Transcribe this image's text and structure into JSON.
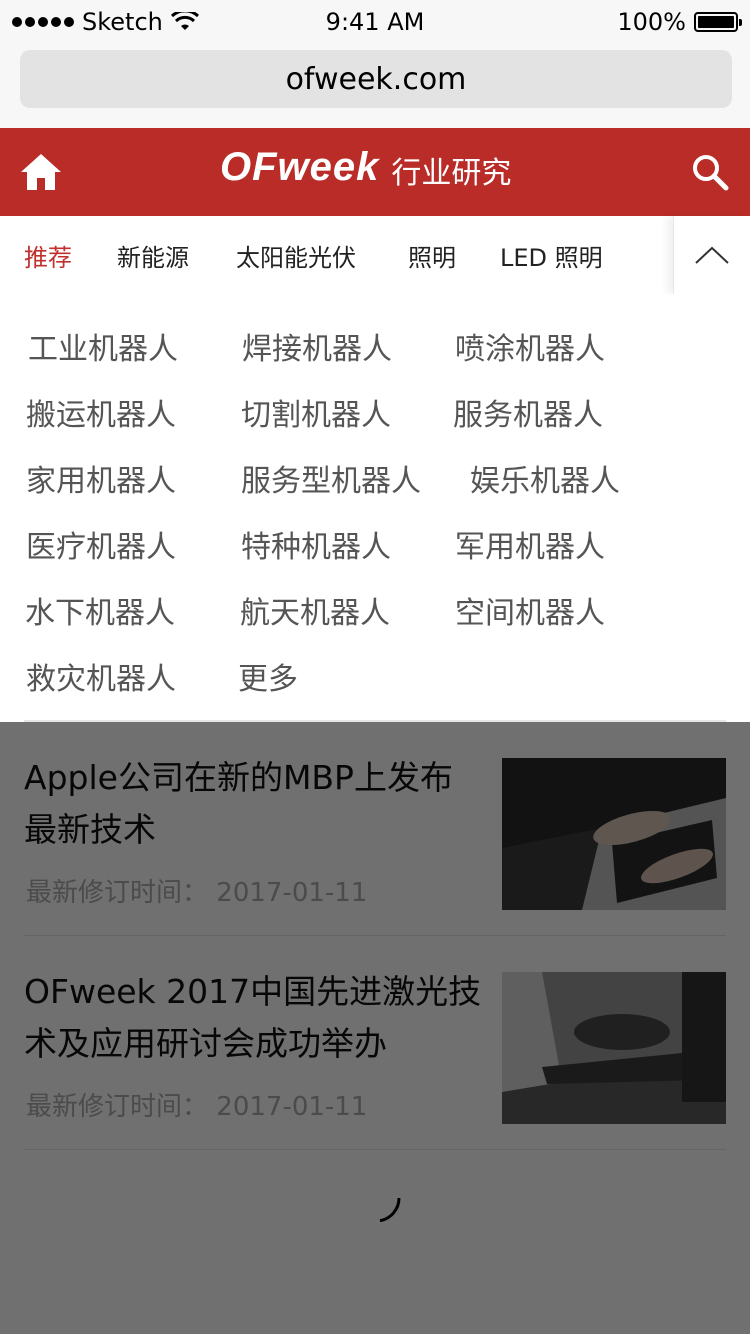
{
  "status_bar": {
    "carrier": "Sketch",
    "time": "9:41 AM",
    "battery": "100%"
  },
  "browser": {
    "url": "ofweek.com"
  },
  "header": {
    "brand": "OFweek",
    "subtitle": "行业研究"
  },
  "tabs": [
    {
      "label": "推荐"
    },
    {
      "label": "新能源"
    },
    {
      "label": "太阳能光伏"
    },
    {
      "label": "照明"
    },
    {
      "label": "LED 照明"
    }
  ],
  "categories": [
    {
      "label": "工业机器人"
    },
    {
      "label": "焊接机器人"
    },
    {
      "label": "喷涂机器人"
    },
    {
      "label": "搬运机器人"
    },
    {
      "label": "切割机器人"
    },
    {
      "label": "服务机器人"
    },
    {
      "label": "家用机器人"
    },
    {
      "label": "服务型机器人"
    },
    {
      "label": "娱乐机器人"
    },
    {
      "label": "医疗机器人"
    },
    {
      "label": "特种机器人"
    },
    {
      "label": "军用机器人"
    },
    {
      "label": "水下机器人"
    },
    {
      "label": "航天机器人"
    },
    {
      "label": "空间机器人"
    },
    {
      "label": "救灾机器人"
    },
    {
      "label": "更多"
    }
  ],
  "articles": [
    {
      "title": "Apple公司在新的MBP上发布最新技术",
      "meta_label": "最新修订时间：",
      "date": "2017-01-11"
    },
    {
      "title": "OFweek 2017中国先进激光技术及应用研讨会成功举办",
      "meta_label": "最新修订时间：",
      "date": "2017-01-11"
    }
  ],
  "colors": {
    "brand_red": "#b92c28",
    "active_tab": "#c0302c",
    "overlay": "rgba(0,0,0,0.56)"
  }
}
